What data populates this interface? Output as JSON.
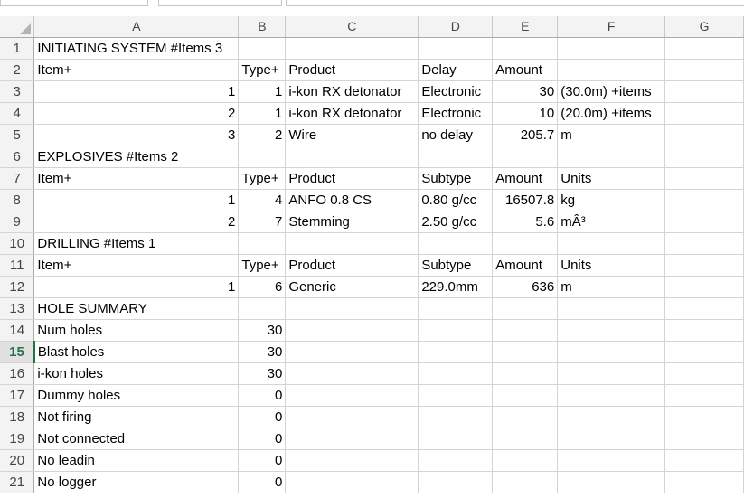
{
  "columns": [
    "A",
    "B",
    "C",
    "D",
    "E",
    "F",
    "G"
  ],
  "rows": [
    {
      "n": "1",
      "cells": [
        "INITIATING SYSTEM #Items 3",
        "",
        "",
        "",
        "",
        "",
        ""
      ]
    },
    {
      "n": "2",
      "cells": [
        "Item+",
        "Type+",
        "Product",
        "Delay",
        "Amount",
        "",
        ""
      ]
    },
    {
      "n": "3",
      "cells": [
        "1",
        "1",
        "i-kon RX detonator",
        "Electronic",
        "30",
        "(30.0m) +items",
        ""
      ]
    },
    {
      "n": "4",
      "cells": [
        "2",
        "1",
        "i-kon RX detonator",
        "Electronic",
        "10",
        "(20.0m) +items",
        ""
      ]
    },
    {
      "n": "5",
      "cells": [
        "3",
        "2",
        "Wire",
        "no delay",
        "205.7",
        "m",
        ""
      ]
    },
    {
      "n": "6",
      "cells": [
        "EXPLOSIVES #Items 2",
        "",
        "",
        "",
        "",
        "",
        ""
      ]
    },
    {
      "n": "7",
      "cells": [
        "Item+",
        "Type+",
        "Product",
        "Subtype",
        "Amount",
        "Units",
        ""
      ]
    },
    {
      "n": "8",
      "cells": [
        "1",
        "4",
        "ANFO 0.8 CS",
        "0.80 g/cc",
        "16507.8",
        "kg",
        ""
      ]
    },
    {
      "n": "9",
      "cells": [
        "2",
        "7",
        "Stemming",
        "2.50 g/cc",
        "5.6",
        "mÂ³",
        ""
      ]
    },
    {
      "n": "10",
      "cells": [
        "DRILLING #Items 1",
        "",
        "",
        "",
        "",
        "",
        ""
      ]
    },
    {
      "n": "11",
      "cells": [
        "Item+",
        "Type+",
        "Product",
        "Subtype",
        "Amount",
        "Units",
        ""
      ]
    },
    {
      "n": "12",
      "cells": [
        "1",
        "6",
        "Generic",
        "229.0mm",
        "636",
        "m",
        ""
      ]
    },
    {
      "n": "13",
      "cells": [
        "HOLE SUMMARY",
        "",
        "",
        "",
        "",
        "",
        ""
      ]
    },
    {
      "n": "14",
      "cells": [
        "Num holes",
        "30",
        "",
        "",
        "",
        "",
        ""
      ]
    },
    {
      "n": "15",
      "cells": [
        "Blast holes",
        "30",
        "",
        "",
        "",
        "",
        ""
      ]
    },
    {
      "n": "16",
      "cells": [
        "i-kon holes",
        "30",
        "",
        "",
        "",
        "",
        ""
      ]
    },
    {
      "n": "17",
      "cells": [
        "Dummy holes",
        "0",
        "",
        "",
        "",
        "",
        ""
      ]
    },
    {
      "n": "18",
      "cells": [
        "Not firing",
        "0",
        "",
        "",
        "",
        "",
        ""
      ]
    },
    {
      "n": "19",
      "cells": [
        "Not connected",
        "0",
        "",
        "",
        "",
        "",
        ""
      ]
    },
    {
      "n": "20",
      "cells": [
        "No leadin",
        "0",
        "",
        "",
        "",
        "",
        ""
      ]
    },
    {
      "n": "21",
      "cells": [
        "No logger",
        "0",
        "",
        "",
        "",
        "",
        ""
      ]
    }
  ],
  "active_row": "15",
  "colors": {
    "accent": "#217346",
    "header_bg": "#f3f3f3",
    "gridline": "#d4d4d4"
  }
}
